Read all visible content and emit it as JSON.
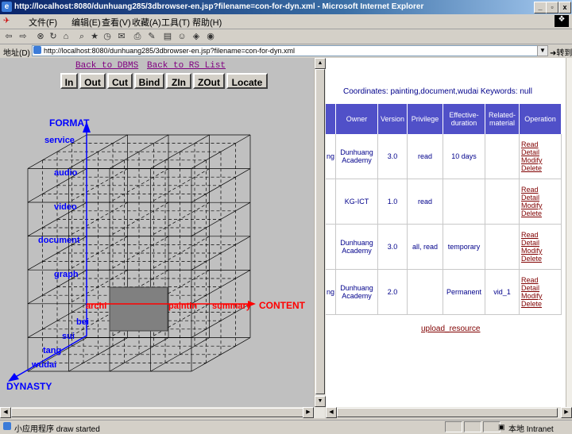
{
  "window": {
    "title": "http://localhost:8080/dunhuang285/3dbrowser-en.jsp?filename=con-for-dyn.xml - Microsoft Internet Explorer",
    "controls": [
      "_",
      "ͦ",
      "x"
    ]
  },
  "menu": [
    "文件(F)",
    "编辑(E)",
    "查看(V)",
    "收藏(A)",
    "工具(T)",
    "帮助(H)"
  ],
  "address": {
    "label": "地址(D)",
    "url": "http://localhost:8080/dunhuang285/3dbrowser-en.jsp?filename=con-for-dyn.xml",
    "go_label": "转到"
  },
  "left": {
    "links": [
      "Back to DBMS",
      "Back to RS List"
    ],
    "buttons": [
      "In",
      "Out",
      "Cut",
      "Bind",
      "ZIn",
      "ZOut",
      "Locate"
    ],
    "axes": {
      "z_title": "FORMAT",
      "z_labels": [
        "service",
        "audio",
        "video",
        "document",
        "graph"
      ],
      "x_title": "CONTENT",
      "x_labels": [
        "archi",
        "paintin",
        "summary"
      ],
      "y_title": "DYNASTY",
      "y_labels": [
        "bei",
        "sui",
        "tang",
        "wudai"
      ]
    }
  },
  "right": {
    "coordinates": "Coordinates: painting,document,wudai  Keywords: null",
    "headers": [
      "Owner",
      "Version",
      "Privilege",
      "Effective-\nduration",
      "Related-\nmaterial",
      "Operation"
    ],
    "rows": [
      {
        "cut": "ng",
        "owner": "Dunhuang Academy",
        "version": "3.0",
        "privilege": "read",
        "duration": "10 days",
        "related": ""
      },
      {
        "cut": "",
        "owner": "KG-ICT",
        "version": "1.0",
        "privilege": "read",
        "duration": "",
        "related": ""
      },
      {
        "cut": "",
        "owner": "Dunhuang Academy",
        "version": "3.0",
        "privilege": "all, read",
        "duration": "temporary",
        "related": ""
      },
      {
        "cut": "ng",
        "owner": "Dunhuang Academy",
        "version": "2.0",
        "privilege": "",
        "duration": "Permanent",
        "related": "vid_1"
      }
    ],
    "operations": [
      "Read",
      "Detail",
      "Modify",
      "Delete"
    ],
    "upload_label": "upload_resource"
  },
  "status": {
    "text": "小应用程序 draw started",
    "zone": "本地 Intranet"
  },
  "colors": {
    "axis": "#0000ff",
    "content": "#ff0000",
    "header": "#5050c8",
    "link": "#800000"
  }
}
